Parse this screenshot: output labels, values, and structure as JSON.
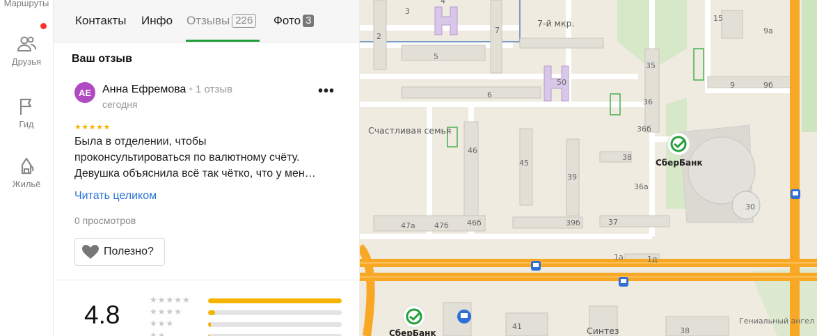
{
  "rail": {
    "items": [
      {
        "label": "Маршруты",
        "icon": "route-icon"
      },
      {
        "label": "Друзья",
        "icon": "friends-icon"
      },
      {
        "label": "Гид",
        "icon": "flag-icon"
      },
      {
        "label": "Жильё",
        "icon": "housing-icon"
      }
    ]
  },
  "tabs": {
    "contacts": "Контакты",
    "info": "Инфо",
    "reviews": "Отзывы",
    "reviews_count": "226",
    "photos": "Фото",
    "photos_count": "3"
  },
  "review": {
    "section_title": "Ваш отзыв",
    "avatar_initials": "АЕ",
    "author": "Анна Ефремова",
    "separator": "•",
    "author_reviews": "1 отзыв",
    "date": "сегодня",
    "more": "•••",
    "stars": "★★★★★",
    "stars_value": 5,
    "text_lines": [
      "Была в отделении, чтобы",
      "проконсультироваться по валютному счёту.",
      "Девушка объяснила всё так чётко, что у мен…"
    ],
    "read_more": "Читать целиком",
    "views": "0 просмотров",
    "helpful": "Полезно?"
  },
  "summary": {
    "rating": "4.8",
    "distribution": [
      {
        "stars": "★★★★★",
        "fraction": 1.0
      },
      {
        "stars": "★★★★",
        "fraction": 0.05
      },
      {
        "stars": "★★★",
        "fraction": 0.02
      },
      {
        "stars": "★★",
        "fraction": 0.01
      }
    ]
  },
  "map": {
    "district": "7-й мкр.",
    "poi_name": "Счастливая семья",
    "bank": "СберБанк",
    "bank_bottom": "СберБанк",
    "bottom_poi": "Синтез",
    "street": "Гениальный ангел",
    "house_numbers": [
      "2",
      "7",
      "3",
      "4",
      "5",
      "6",
      "15",
      "9а",
      "9",
      "9б",
      "50",
      "35",
      "36",
      "36б",
      "46",
      "45",
      "39",
      "38",
      "36а",
      "30",
      "47а",
      "47б",
      "46б",
      "39б",
      "37",
      "1а",
      "1д",
      "41",
      "38"
    ]
  },
  "colors": {
    "accent_green": "#1f9d3a",
    "link_blue": "#2a73d6",
    "star_yellow": "#f5b400",
    "avatar_purple": "#b04ac0",
    "road_orange": "#f9a825"
  }
}
